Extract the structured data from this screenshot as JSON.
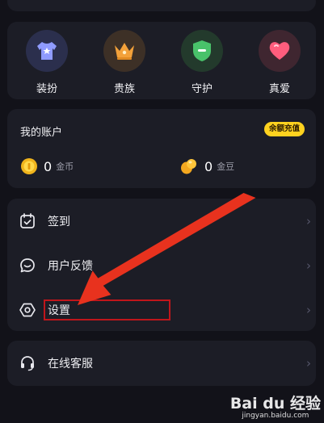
{
  "features": [
    {
      "label": "装扮",
      "icon": "shirt-icon"
    },
    {
      "label": "贵族",
      "icon": "crown-icon"
    },
    {
      "label": "守护",
      "icon": "shield-icon"
    },
    {
      "label": "真爱",
      "icon": "heart-icon"
    }
  ],
  "account": {
    "title": "我的账户",
    "recharge_label": "余额充值",
    "coins": {
      "value": "0",
      "unit": "金币"
    },
    "beans": {
      "value": "0",
      "unit": "金豆"
    }
  },
  "menu": [
    {
      "label": "签到",
      "icon": "calendar-check-icon"
    },
    {
      "label": "用户反馈",
      "icon": "chat-bubble-icon"
    },
    {
      "label": "设置",
      "icon": "hexagon-settings-icon"
    }
  ],
  "service": {
    "label": "在线客服",
    "icon": "headset-icon"
  },
  "watermark": {
    "main": "Bai du 经验",
    "sub": "jingyan.baidu.com"
  },
  "colors": {
    "accent_yellow": "#ffd21f",
    "annotation_red": "#e8321e",
    "card": "#1c1d26",
    "background": "#121219"
  }
}
